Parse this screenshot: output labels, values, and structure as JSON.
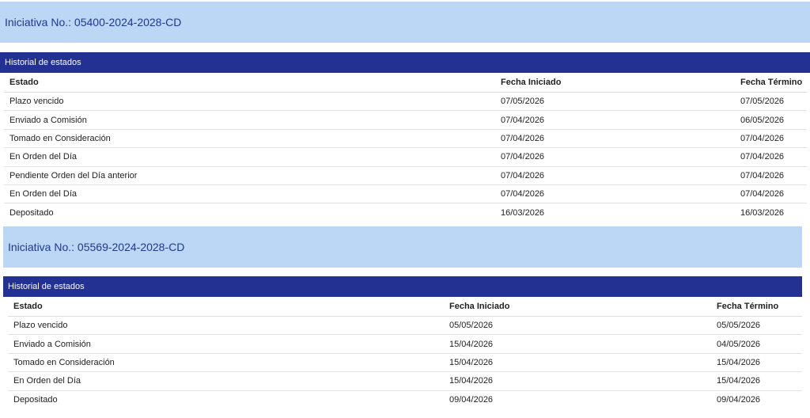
{
  "iniciativas": [
    {
      "title": "Iniciativa No.: 05400-2024-2028-CD",
      "historial_label": "Historial de estados",
      "columns": [
        "Estado",
        "Fecha Iniciado",
        "Fecha Término"
      ],
      "rows": [
        [
          "Plazo vencido",
          "07/05/2026",
          "07/05/2026"
        ],
        [
          "Enviado a Comisión",
          "07/04/2026",
          "06/05/2026"
        ],
        [
          "Tomado en Consideración",
          "07/04/2026",
          "07/04/2026"
        ],
        [
          "En Orden del Día",
          "07/04/2026",
          "07/04/2026"
        ],
        [
          "Pendiente Orden del Día anterior",
          "07/04/2026",
          "07/04/2026"
        ],
        [
          "En Orden del Día",
          "07/04/2026",
          "07/04/2026"
        ],
        [
          "Depositado",
          "16/03/2026",
          "16/03/2026"
        ]
      ]
    },
    {
      "title": "Iniciativa No.: 05569-2024-2028-CD",
      "historial_label": "Historial de estados",
      "columns": [
        "Estado",
        "Fecha Iniciado",
        "Fecha Término"
      ],
      "rows": [
        [
          "Plazo vencido",
          "05/05/2026",
          "05/05/2026"
        ],
        [
          "Enviado a Comisión",
          "15/04/2026",
          "04/05/2026"
        ],
        [
          "Tomado en Consideración",
          "15/04/2026",
          "15/04/2026"
        ],
        [
          "En Orden del Día",
          "15/04/2026",
          "15/04/2026"
        ],
        [
          "Depositado",
          "09/04/2026",
          "09/04/2026"
        ]
      ]
    }
  ]
}
